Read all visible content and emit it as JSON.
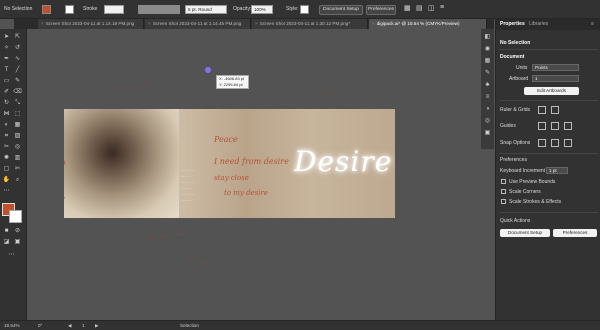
{
  "control_bar": {
    "selection_label": "No Selection",
    "stroke_label": "Stroke",
    "brush_value": "5 pt. Round",
    "opacity_label": "Opacity:",
    "opacity_value": "100%",
    "style_label": "Style:",
    "document_setup": "Document Setup",
    "preferences": "Preferences"
  },
  "tabs": [
    "Screen Shot 2023-04-11 at 1.14.18 PM.png",
    "Screen Shot 2023-04-11 at 1.14.45 PM.png",
    "Screen Shot 2023-04-11 at 1.30.12 PM.png*",
    "digipack.ai* @ 18.54 % (CMYK/Preview)"
  ],
  "panel": {
    "tab_properties": "Properties",
    "tab_libraries": "Libraries",
    "no_selection": "No Selection",
    "document_heading": "Document",
    "units_label": "Units",
    "units_value": "Points",
    "artboard_label": "Artboard",
    "artboard_value": "1",
    "edit_artboards": "Edit Artboards",
    "rulers_grids": "Ruler & Grids",
    "guides": "Guides",
    "snap_options": "Snap Options",
    "preferences_heading": "Preferences",
    "keyboard_increment_label": "Keyboard Increment",
    "keyboard_increment_value": "1 pt",
    "use_preview_bounds": "Use Preview Bounds",
    "scale_corners": "Scale Corners",
    "scale_strokes": "Scale Strokes & Effects",
    "quick_actions": "Quick Actions",
    "document_setup_btn": "Document Setup",
    "preferences_btn": "Preferences"
  },
  "tooltip": {
    "x": "X: -4606.83 pt",
    "y": "Y: 2295.84 pt"
  },
  "artwork": {
    "title_glow": "Desire",
    "side_text": "desi",
    "lyric_lines": [
      "Peace",
      "I need from desire",
      "stay close",
      "to my desire"
    ]
  },
  "status_bar": {
    "zoom": "18.54%",
    "rotation": "0°",
    "artboard_num": "1",
    "tool": "Selection"
  },
  "colors": {
    "fill": "#c1502c",
    "stroke": "#ffffff",
    "accent_handwriting": "#b8503a"
  }
}
